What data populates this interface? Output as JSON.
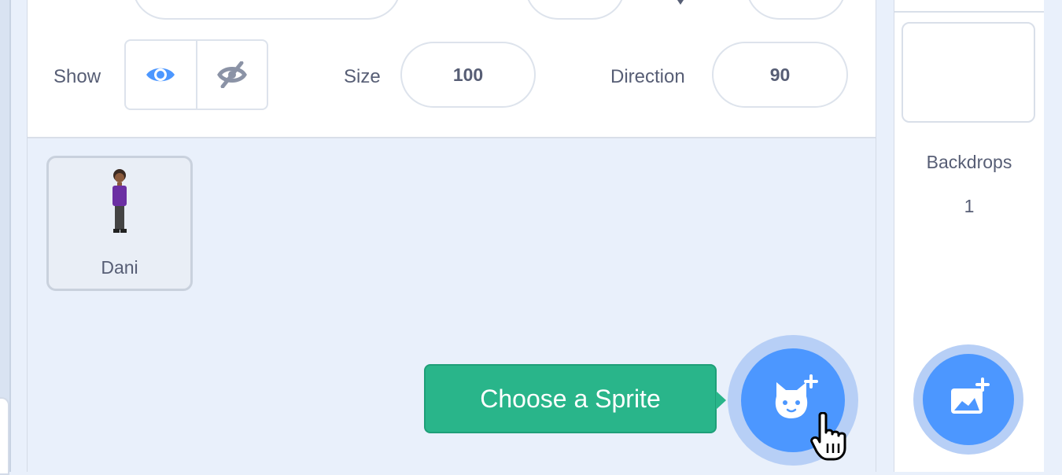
{
  "sprite_info": {
    "show_label": "Show",
    "size_label": "Size",
    "size_value": "100",
    "direction_label": "Direction",
    "direction_value": "90",
    "show_visible_icon": "eye-icon",
    "show_hidden_icon": "eye-slash-icon"
  },
  "sprites": [
    {
      "name": "Dani",
      "selected": true
    }
  ],
  "tooltip": {
    "text": "Choose a Sprite"
  },
  "add_sprite_button": {
    "icon": "cat-plus-icon"
  },
  "stage": {
    "backdrops_label": "Backdrops",
    "backdrops_count": "1",
    "add_backdrop_icon": "image-plus-icon"
  },
  "colors": {
    "accent": "#4c97ff",
    "tooltip": "#29b58a",
    "text": "#575e75",
    "panel_bg": "#e9f0fb"
  }
}
